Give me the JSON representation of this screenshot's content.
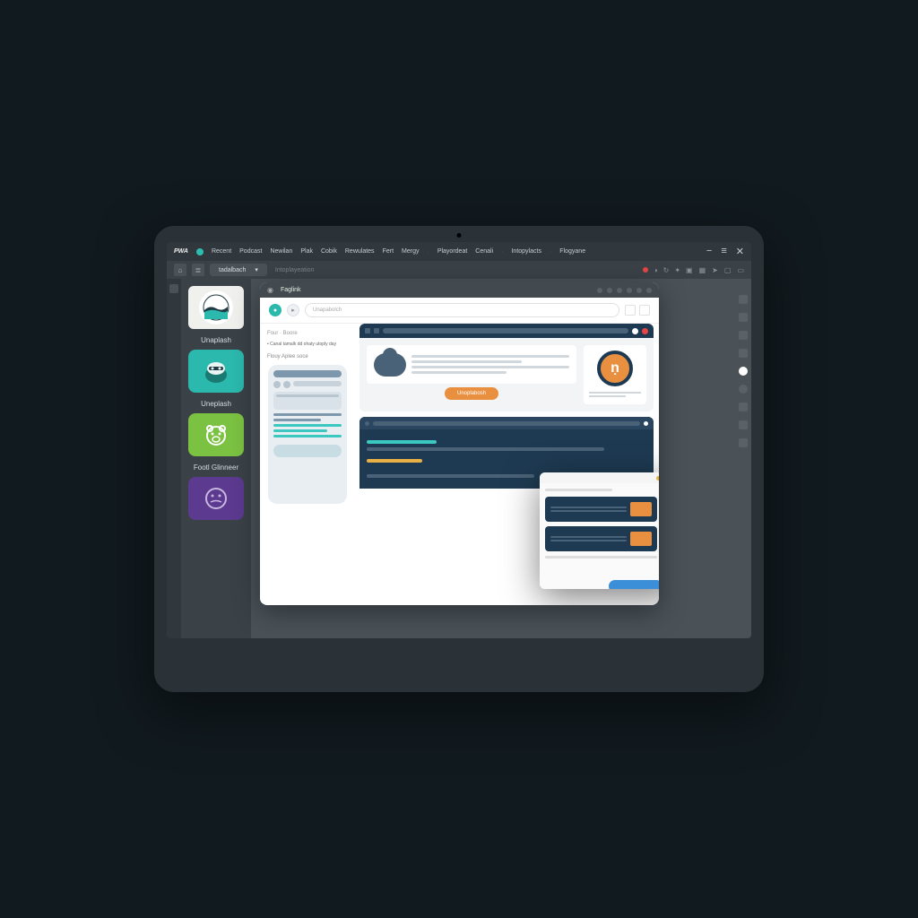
{
  "menubar": {
    "logo": "PWA",
    "items": [
      "Recent",
      "Podcast",
      "Newilan",
      "Plak",
      "Cobik",
      "Rewulates",
      "Fert",
      "Mergy"
    ],
    "crumb1": "Playordeat",
    "crumb2": "Cenali",
    "crumb3": "Intopylacts",
    "crumb4": "Flogyane"
  },
  "toolbar": {
    "tab": "tadalbach",
    "addr": "Intoplayeation"
  },
  "sidebar": [
    {
      "label": "Unaplash"
    },
    {
      "label": "Uneplash"
    },
    {
      "label": "Footl Glinneer"
    },
    {
      "label": ""
    }
  ],
  "browser": {
    "title": "Faglink",
    "url": "Unapabolch",
    "crumb": "Four · Boore",
    "bullet": "Canal tamalk dd ohaty utoply day",
    "sidelabel": "Flouy Aplee soce",
    "orange_pill": "Unoplabosh"
  },
  "colors": {
    "red": "#e84545",
    "green": "#4bc77a",
    "yellow": "#e8b045",
    "teal": "#2dbdb0",
    "orange": "#e89040",
    "navy": "#1e3a52",
    "blue": "#3a8fd8",
    "cyan": "#3ac8c0"
  }
}
